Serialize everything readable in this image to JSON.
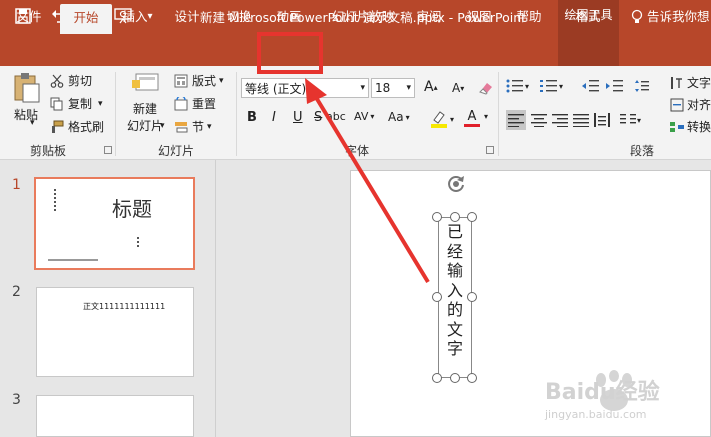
{
  "titlebar": {
    "title": "新建 Microsoft PowerPoint 演示文稿.pptx  -  PowerPoint",
    "tool_tab": "绘图工具"
  },
  "tabs": [
    "文件",
    "开始",
    "插入",
    "设计",
    "切换",
    "动画",
    "幻灯片放映",
    "审阅",
    "视图",
    "帮助",
    "格式"
  ],
  "tell_me": "告诉我你想",
  "clipboard": {
    "paste": "粘贴",
    "cut": "剪切",
    "copy": "复制",
    "format_painter": "格式刷",
    "label": "剪贴板"
  },
  "slides_group": {
    "new_slide_1": "新建",
    "new_slide_2": "幻灯片",
    "layout": "版式",
    "reset": "重置",
    "section": "节",
    "label": "幻灯片"
  },
  "font": {
    "font_name": "等线 (正文)",
    "font_size": "18",
    "label": "字体"
  },
  "paragraph": {
    "label": "段落",
    "text_direction": "文字",
    "align_text": "对齐",
    "convert": "转换"
  },
  "thumbnails": [
    {
      "number": "1",
      "title": "标题"
    },
    {
      "number": "2",
      "body": "正文1111111111111"
    },
    {
      "number": "3"
    }
  ],
  "slide": {
    "vertical_text": "已经输入的文字"
  },
  "watermark": {
    "text": "Baidu经验",
    "url": "jingyan.baidu.com"
  }
}
